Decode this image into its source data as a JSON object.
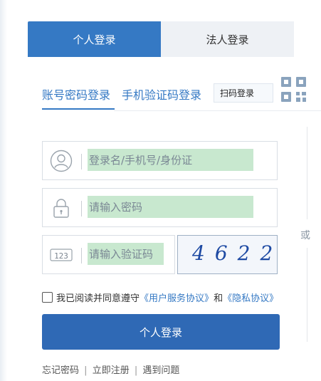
{
  "tabs": {
    "personal_label": "个人登录",
    "corporate_label": "法人登录"
  },
  "subtabs": {
    "account_label": "账号密码登录",
    "sms_label": "手机验证码登录",
    "qr_label": "扫码登录"
  },
  "form": {
    "username_placeholder": "登录名/手机号/身份证",
    "password_placeholder": "请输入密码",
    "captcha_placeholder": "请输入验证码",
    "captcha_code": "4622",
    "captcha_icon_text": "123"
  },
  "divider": {
    "or_label": "或"
  },
  "agreement": {
    "prefix": "我已阅读并同意遵守",
    "open_quote_1": "《",
    "service_link": "用户服务协议",
    "close_quote_1": "》",
    "and": "和",
    "open_quote_2": "《",
    "privacy_link": "隐私协议",
    "close_quote_2": "》"
  },
  "login_button_label": "个人登录",
  "footer": {
    "forgot_password": "忘记密码",
    "register": "立即注册",
    "help": "遇到问题",
    "separator": "|"
  },
  "colors": {
    "primary": "#3579c4",
    "button": "#2f69b5",
    "tab_inactive": "#eef1f5",
    "autofill_highlight": "#c8e8cf"
  },
  "icons": {
    "username": "user-icon",
    "password": "lock-icon",
    "captcha": "keypad-icon",
    "qr": "qr-code-icon"
  }
}
